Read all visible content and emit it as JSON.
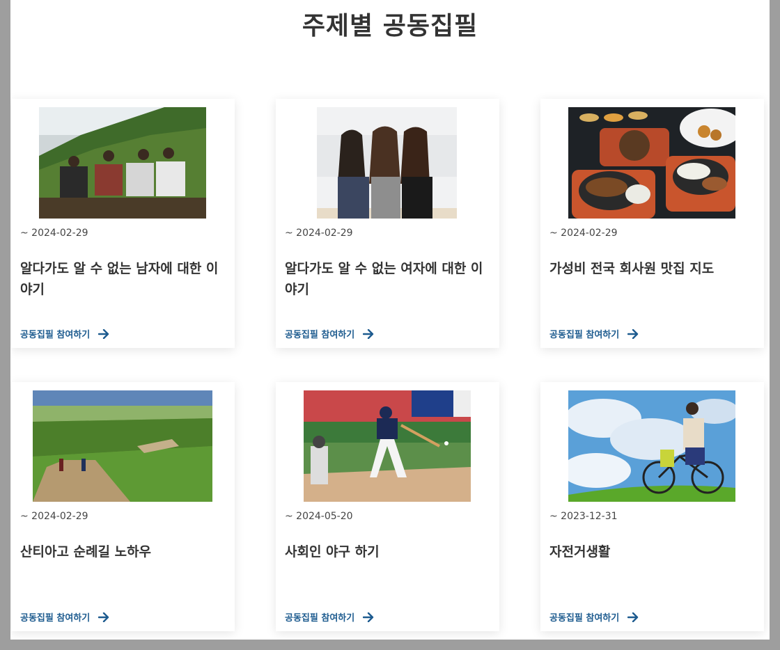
{
  "page": {
    "title": "주제별 공동집필"
  },
  "cards": [
    {
      "image": "friends-on-hill-photo",
      "date": "~ 2024-02-29",
      "title": "알다가도 알 수 없는 남자에 대한 이야기",
      "cta": "공동집필 참여하기"
    },
    {
      "image": "three-women-photo",
      "date": "~ 2024-02-29",
      "title": "알다가도 알 수 없는 여자에 대한 이야기",
      "cta": "공동집필 참여하기"
    },
    {
      "image": "food-platters-photo",
      "date": "~ 2024-02-29",
      "title": "가성비 전국 회사원 맛집 지도",
      "cta": "공동집필 참여하기"
    },
    {
      "image": "pilgrimage-road-photo",
      "date": "~ 2024-02-29",
      "title": "산티아고 순례길 노하우",
      "cta": "공동집필 참여하기"
    },
    {
      "image": "baseball-batter-photo",
      "date": "~ 2024-05-20",
      "title": "사회인 야구 하기",
      "cta": "공동집필 참여하기"
    },
    {
      "image": "bicycle-rider-photo",
      "date": "~ 2023-12-31",
      "title": "자전거생활",
      "cta": "공동집필 참여하기"
    }
  ],
  "colors": {
    "cta": "#1d5b8f",
    "title_text": "#333333",
    "backdrop": "#9e9e9e"
  }
}
